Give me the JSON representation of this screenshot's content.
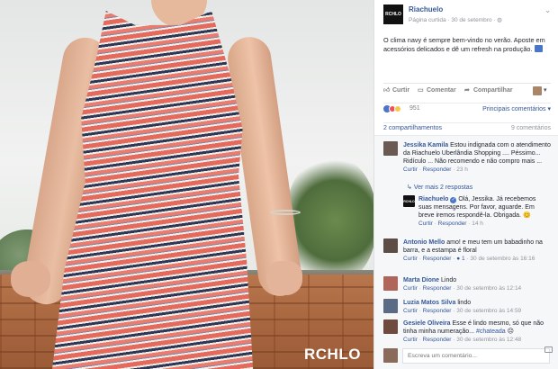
{
  "photo": {
    "watermark": "RCHLO"
  },
  "post": {
    "page_name": "Riachuelo",
    "page_logo_text": "RCHLO",
    "meta": "Página curtida · 30 de setembro ·",
    "text": "O clima navy é sempre bem-vindo no verão. Aposte em acessórios delicados e dê um refresh na produção."
  },
  "actions": {
    "like": "Curtir",
    "comment": "Comentar",
    "share": "Compartilhar"
  },
  "reactions": {
    "count": "951",
    "sort": "Principais comentários ▾"
  },
  "counts": {
    "shares": "2 compartilhamentos",
    "comments": "9 comentários"
  },
  "comments": [
    {
      "name": "Jessika Kamila",
      "text": "Estou indignada com o atendimento da Riachuelo Uberlândia Shopping .... Péssimo... Ridículo ... Não recomendo e não compro mais ...",
      "meta": [
        "Curtir",
        "Responder",
        "23 h"
      ]
    },
    {
      "more_replies": "Ver mais 2 respostas"
    },
    {
      "name": "Riachuelo",
      "text": "Olá, Jessika. Já recebemos suas mensagens. Por favor, aguarde. Em breve iremos respondê-la. Obrigada. 😊",
      "meta": [
        "Curtir",
        "Responder",
        "14 h"
      ]
    },
    {
      "name": "Antonio Mello",
      "text": "amo! e meu tem um babadinho na barra, e a estampa é floral",
      "meta": [
        "Curtir",
        "Responder",
        "1",
        "30 de setembro às 16:16"
      ]
    },
    {
      "name": "Marta Dione",
      "text": "Lindo",
      "meta": [
        "Curtir",
        "Responder",
        "30 de setembro às 12:14"
      ]
    },
    {
      "name": "Luzia Matos Silva",
      "text": "lindo",
      "meta": [
        "Curtir",
        "Responder",
        "30 de setembro às 14:59"
      ]
    },
    {
      "name": "Gesiele Oliveira",
      "text": "Esse é lindo mesmo, só que não tinha minha numeração...",
      "hashtag": "#chateada",
      "meta": [
        "Curtir",
        "Responder",
        "30 de setembro às 12:48"
      ]
    }
  ],
  "write": {
    "placeholder": "Escreva um comentário..."
  },
  "colors": {
    "link": "#365899",
    "like": "#4a76c8",
    "love": "#f0505f",
    "wow": "#f7c84a",
    "muted": "#90949c"
  }
}
